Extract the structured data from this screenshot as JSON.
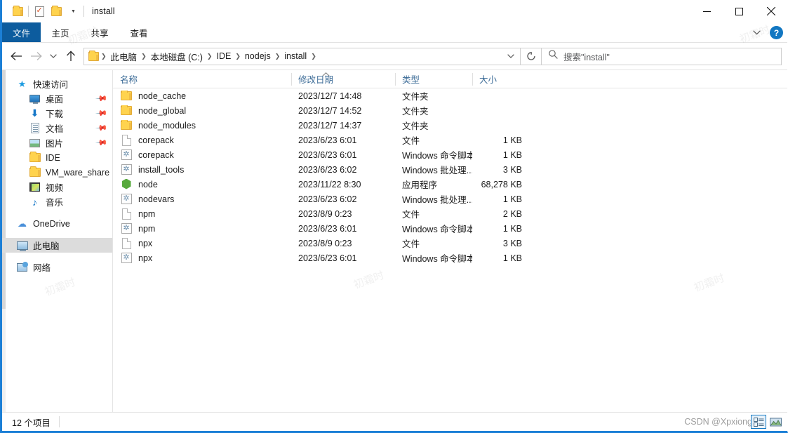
{
  "window": {
    "title": "install",
    "quick_access": [
      {
        "name": "folder-icon",
        "label": ""
      },
      {
        "name": "properties-icon",
        "label": ""
      },
      {
        "name": "new-folder-icon",
        "label": ""
      }
    ],
    "controls": {
      "minimize": "minimize",
      "maximize": "maximize",
      "close": "close"
    }
  },
  "ribbon": {
    "tabs": [
      {
        "label": "文件",
        "selected": true
      },
      {
        "label": "主页",
        "selected": false
      },
      {
        "label": "共享",
        "selected": false
      },
      {
        "label": "查看",
        "selected": false
      }
    ],
    "collapse_icon": "chevron-down-icon",
    "help_label": "?"
  },
  "navigation": {
    "back_icon": "arrow-left-icon",
    "forward_icon": "arrow-right-icon",
    "recent_icon": "chevron-down-icon",
    "up_icon": "arrow-up-icon",
    "refresh_icon": "refresh-icon",
    "breadcrumb_dropdown_icon": "chevron-down-icon",
    "breadcrumbs": [
      "此电脑",
      "本地磁盘 (C:)",
      "IDE",
      "nodejs",
      "install"
    ]
  },
  "search": {
    "icon": "search-icon",
    "placeholder": "搜索\"install\""
  },
  "sidebar": {
    "items": [
      {
        "label": "快速访问",
        "icon": "star-icon",
        "level": "root",
        "pinned": false,
        "selected": false
      },
      {
        "label": "桌面",
        "icon": "desktop-icon",
        "level": "child",
        "pinned": true,
        "selected": false
      },
      {
        "label": "下载",
        "icon": "download-icon",
        "level": "child",
        "pinned": true,
        "selected": false
      },
      {
        "label": "文档",
        "icon": "documents-icon",
        "level": "child",
        "pinned": true,
        "selected": false
      },
      {
        "label": "图片",
        "icon": "pictures-icon",
        "level": "child",
        "pinned": true,
        "selected": false
      },
      {
        "label": "IDE",
        "icon": "folder-icon",
        "level": "child",
        "pinned": false,
        "selected": false
      },
      {
        "label": "VM_ware_share",
        "icon": "folder-icon",
        "level": "child",
        "pinned": false,
        "selected": false
      },
      {
        "label": "视频",
        "icon": "videos-icon",
        "level": "child",
        "pinned": false,
        "selected": false
      },
      {
        "label": "音乐",
        "icon": "music-icon",
        "level": "child",
        "pinned": false,
        "selected": false
      },
      {
        "label": "OneDrive",
        "icon": "cloud-icon",
        "level": "root",
        "pinned": false,
        "selected": false,
        "gap_before": true
      },
      {
        "label": "此电脑",
        "icon": "this-pc-icon",
        "level": "root",
        "pinned": false,
        "selected": true,
        "gap_before": true
      },
      {
        "label": "网络",
        "icon": "network-icon",
        "level": "root",
        "pinned": false,
        "selected": false,
        "gap_before": true
      }
    ]
  },
  "file_list": {
    "columns": [
      {
        "label": "名称",
        "key": "name"
      },
      {
        "label": "修改日期",
        "key": "date"
      },
      {
        "label": "类型",
        "key": "type"
      },
      {
        "label": "大小",
        "key": "size"
      }
    ],
    "sort": {
      "column": "名称",
      "direction": "asc",
      "icon": "caret-up-icon"
    },
    "rows": [
      {
        "name": "node_cache",
        "date": "2023/12/7 14:48",
        "type": "文件夹",
        "size": "",
        "icon": "folder-icon"
      },
      {
        "name": "node_global",
        "date": "2023/12/7 14:52",
        "type": "文件夹",
        "size": "",
        "icon": "folder-icon"
      },
      {
        "name": "node_modules",
        "date": "2023/12/7 14:37",
        "type": "文件夹",
        "size": "",
        "icon": "folder-icon"
      },
      {
        "name": "corepack",
        "date": "2023/6/23 6:01",
        "type": "文件",
        "size": "1 KB",
        "icon": "file-icon"
      },
      {
        "name": "corepack",
        "date": "2023/6/23 6:01",
        "type": "Windows 命令脚本",
        "size": "1 KB",
        "icon": "script-icon"
      },
      {
        "name": "install_tools",
        "date": "2023/6/23 6:02",
        "type": "Windows 批处理...",
        "size": "3 KB",
        "icon": "script-icon"
      },
      {
        "name": "node",
        "date": "2023/11/22 8:30",
        "type": "应用程序",
        "size": "68,278 KB",
        "icon": "node-icon"
      },
      {
        "name": "nodevars",
        "date": "2023/6/23 6:02",
        "type": "Windows 批处理...",
        "size": "1 KB",
        "icon": "script-icon"
      },
      {
        "name": "npm",
        "date": "2023/8/9 0:23",
        "type": "文件",
        "size": "2 KB",
        "icon": "file-icon"
      },
      {
        "name": "npm",
        "date": "2023/6/23 6:01",
        "type": "Windows 命令脚本",
        "size": "1 KB",
        "icon": "script-icon"
      },
      {
        "name": "npx",
        "date": "2023/8/9 0:23",
        "type": "文件",
        "size": "3 KB",
        "icon": "file-icon"
      },
      {
        "name": "npx",
        "date": "2023/6/23 6:01",
        "type": "Windows 命令脚本",
        "size": "1 KB",
        "icon": "script-icon"
      }
    ]
  },
  "status": {
    "item_count": "12 个项目",
    "watermark": "CSDN @Xpxiong",
    "view_buttons": [
      {
        "name": "details-view-button",
        "selected": true
      },
      {
        "name": "large-icons-view-button",
        "selected": false
      }
    ]
  },
  "colors": {
    "accent": "#1c7fd6",
    "file_tab": "#0d5c9e",
    "header_text": "#3a6a96",
    "selection": "#dcdcdc",
    "folder": "#ffd34e",
    "node_green": "#57a93c"
  }
}
